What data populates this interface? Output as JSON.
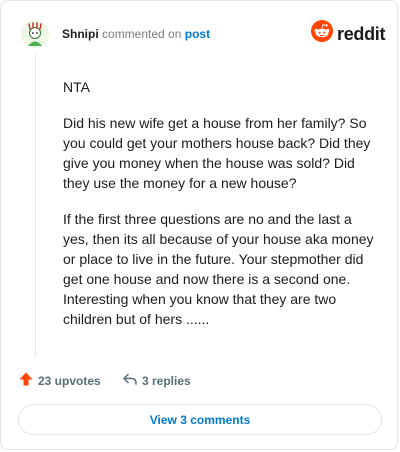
{
  "header": {
    "username": "Shnipi",
    "action": "commented on",
    "target": "post",
    "brand": "reddit"
  },
  "comment": {
    "paragraphs": [
      "NTA",
      "Did his new wife get a house from her family? So you could get your mothers house back? Did they give you money when the house was sold? Did they use the money for a new house?",
      "If the first three questions are no and the last a yes, then its all because of your house aka money or place to live in the future. Your stepmother did get one house and now there is a second one. Interesting when you know that they are two children but of hers ......"
    ]
  },
  "footer": {
    "upvotes_label": "23 upvotes",
    "replies_label": "3 replies",
    "view_comments_label": "View 3 comments"
  },
  "icons": {
    "upvote": "upvote-arrow-icon",
    "reply": "reply-arrow-icon",
    "brand": "reddit-snoo-icon",
    "avatar": "user-avatar"
  },
  "colors": {
    "brand_orange": "#ff4500",
    "link_blue": "#0079d3",
    "meta_gray": "#576f76"
  }
}
